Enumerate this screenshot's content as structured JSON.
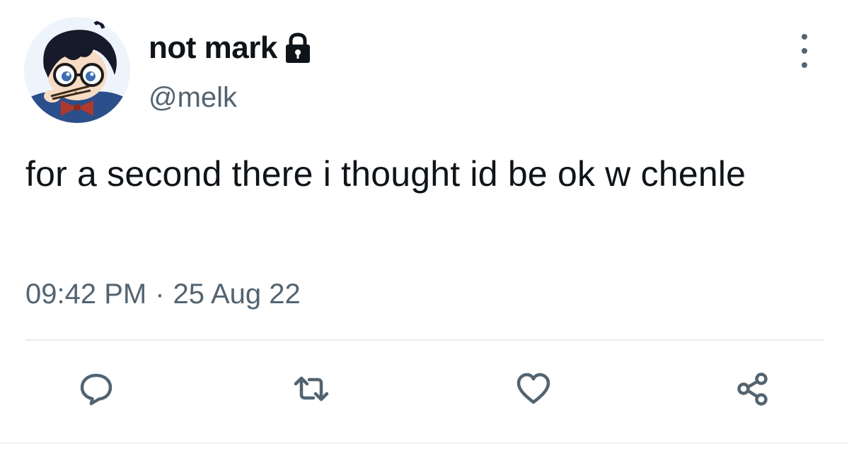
{
  "author": {
    "display_name": "not mark",
    "handle": "@melk",
    "protected": true,
    "avatar": "anime-character-avatar"
  },
  "tweet": {
    "text": "for a second there i thought id be ok w chenle",
    "time": "09:42 PM",
    "separator": "·",
    "date": "25 Aug 22"
  },
  "actions": {
    "reply_icon": "reply-icon",
    "retweet_icon": "retweet-icon",
    "like_icon": "heart-icon",
    "share_icon": "share-icon"
  },
  "colors": {
    "text_primary": "#0f1419",
    "text_secondary": "#536471",
    "icon": "#536471",
    "divider": "#e6ecf0"
  }
}
